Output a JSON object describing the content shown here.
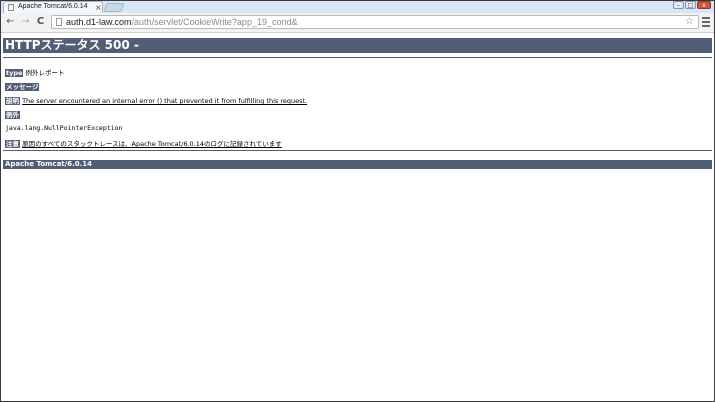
{
  "browser": {
    "tab_title": "Apache Tomcat/6.0.14",
    "tab_close": "×",
    "url_host": "auth.d1-law.com",
    "url_path": "/auth/servlet/CookieWrite?app_19_cond&",
    "back_glyph": "←",
    "forward_glyph": "→",
    "reload_glyph": "C",
    "star_glyph": "☆",
    "win_min": "–",
    "win_max": "□",
    "win_close": "x"
  },
  "page": {
    "heading": "HTTPステータス 500 -",
    "type_label": "type",
    "type_value": "例外レポート",
    "message_label": "メッセージ",
    "description_label": "説明",
    "description_value": "The server encountered an internal error () that prevented it from fulfilling this request.",
    "exception_label": "例外",
    "exception_value": "java.lang.NullPointerException",
    "note_label": "注意",
    "note_value": "原因のすべてのスタックトレースは、Apache Tomcat/6.0.14のログに記録されています",
    "footer": "Apache Tomcat/6.0.14"
  },
  "colors": {
    "header_bg": "#525d76"
  }
}
